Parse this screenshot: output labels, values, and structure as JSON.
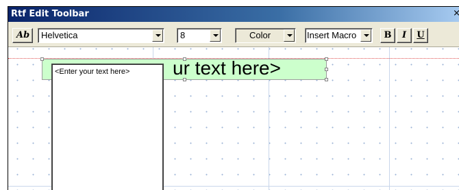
{
  "window": {
    "title": "Rtf Edit Toolbar",
    "close_glyph": "×"
  },
  "toolbar": {
    "ab_label": "Ab",
    "font_value": "Helvetica",
    "size_value": "8",
    "color_label": "Color",
    "macro_value": "Insert Macro",
    "bold_label": "B",
    "italic_label": "I",
    "underline_label": "U"
  },
  "canvas": {
    "large_text": "ur text here>",
    "small_text": "<Enter your text here>"
  },
  "colors": {
    "title_gradient_start": "#0a246a",
    "title_gradient_end": "#a6caf0",
    "toolbar_bg": "#ece9d8",
    "textbox_highlight": "#ccffcc",
    "guide_line": "#e05050"
  }
}
